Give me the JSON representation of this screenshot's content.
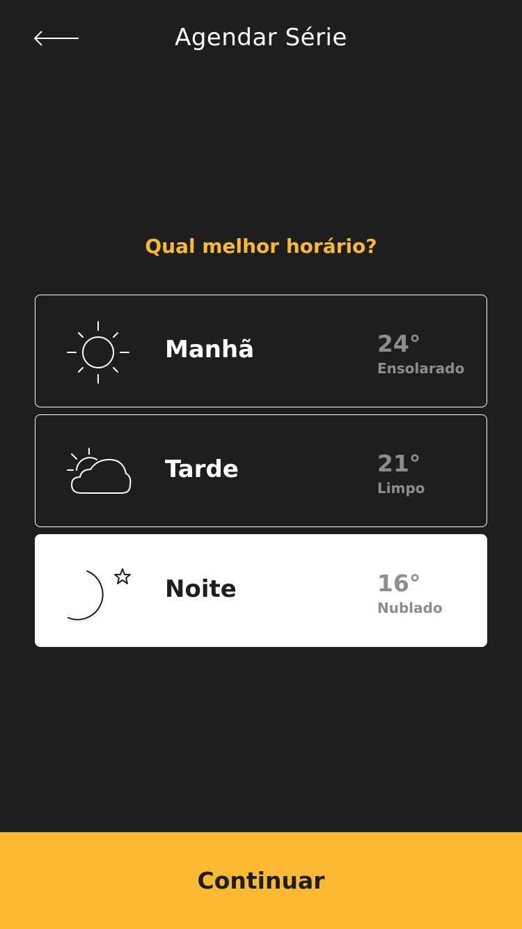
{
  "header": {
    "title": "Agendar Série",
    "back_icon": "arrow-left-icon"
  },
  "question": "Qual melhor horário?",
  "options": [
    {
      "label": "Manhã",
      "temperature": "24°",
      "condition": "Ensolarado",
      "icon": "sun-icon",
      "selected": false
    },
    {
      "label": "Tarde",
      "temperature": "21°",
      "condition": "Limpo",
      "icon": "partly-cloudy-icon",
      "selected": false
    },
    {
      "label": "Noite",
      "temperature": "16°",
      "condition": "Nublado",
      "icon": "moon-star-icon",
      "selected": true
    }
  ],
  "continue_label": "Continuar",
  "colors": {
    "background": "#1e1e1e",
    "accent": "#fbb934",
    "muted_text": "#8d8d8d",
    "card_border": "#ffffff"
  }
}
